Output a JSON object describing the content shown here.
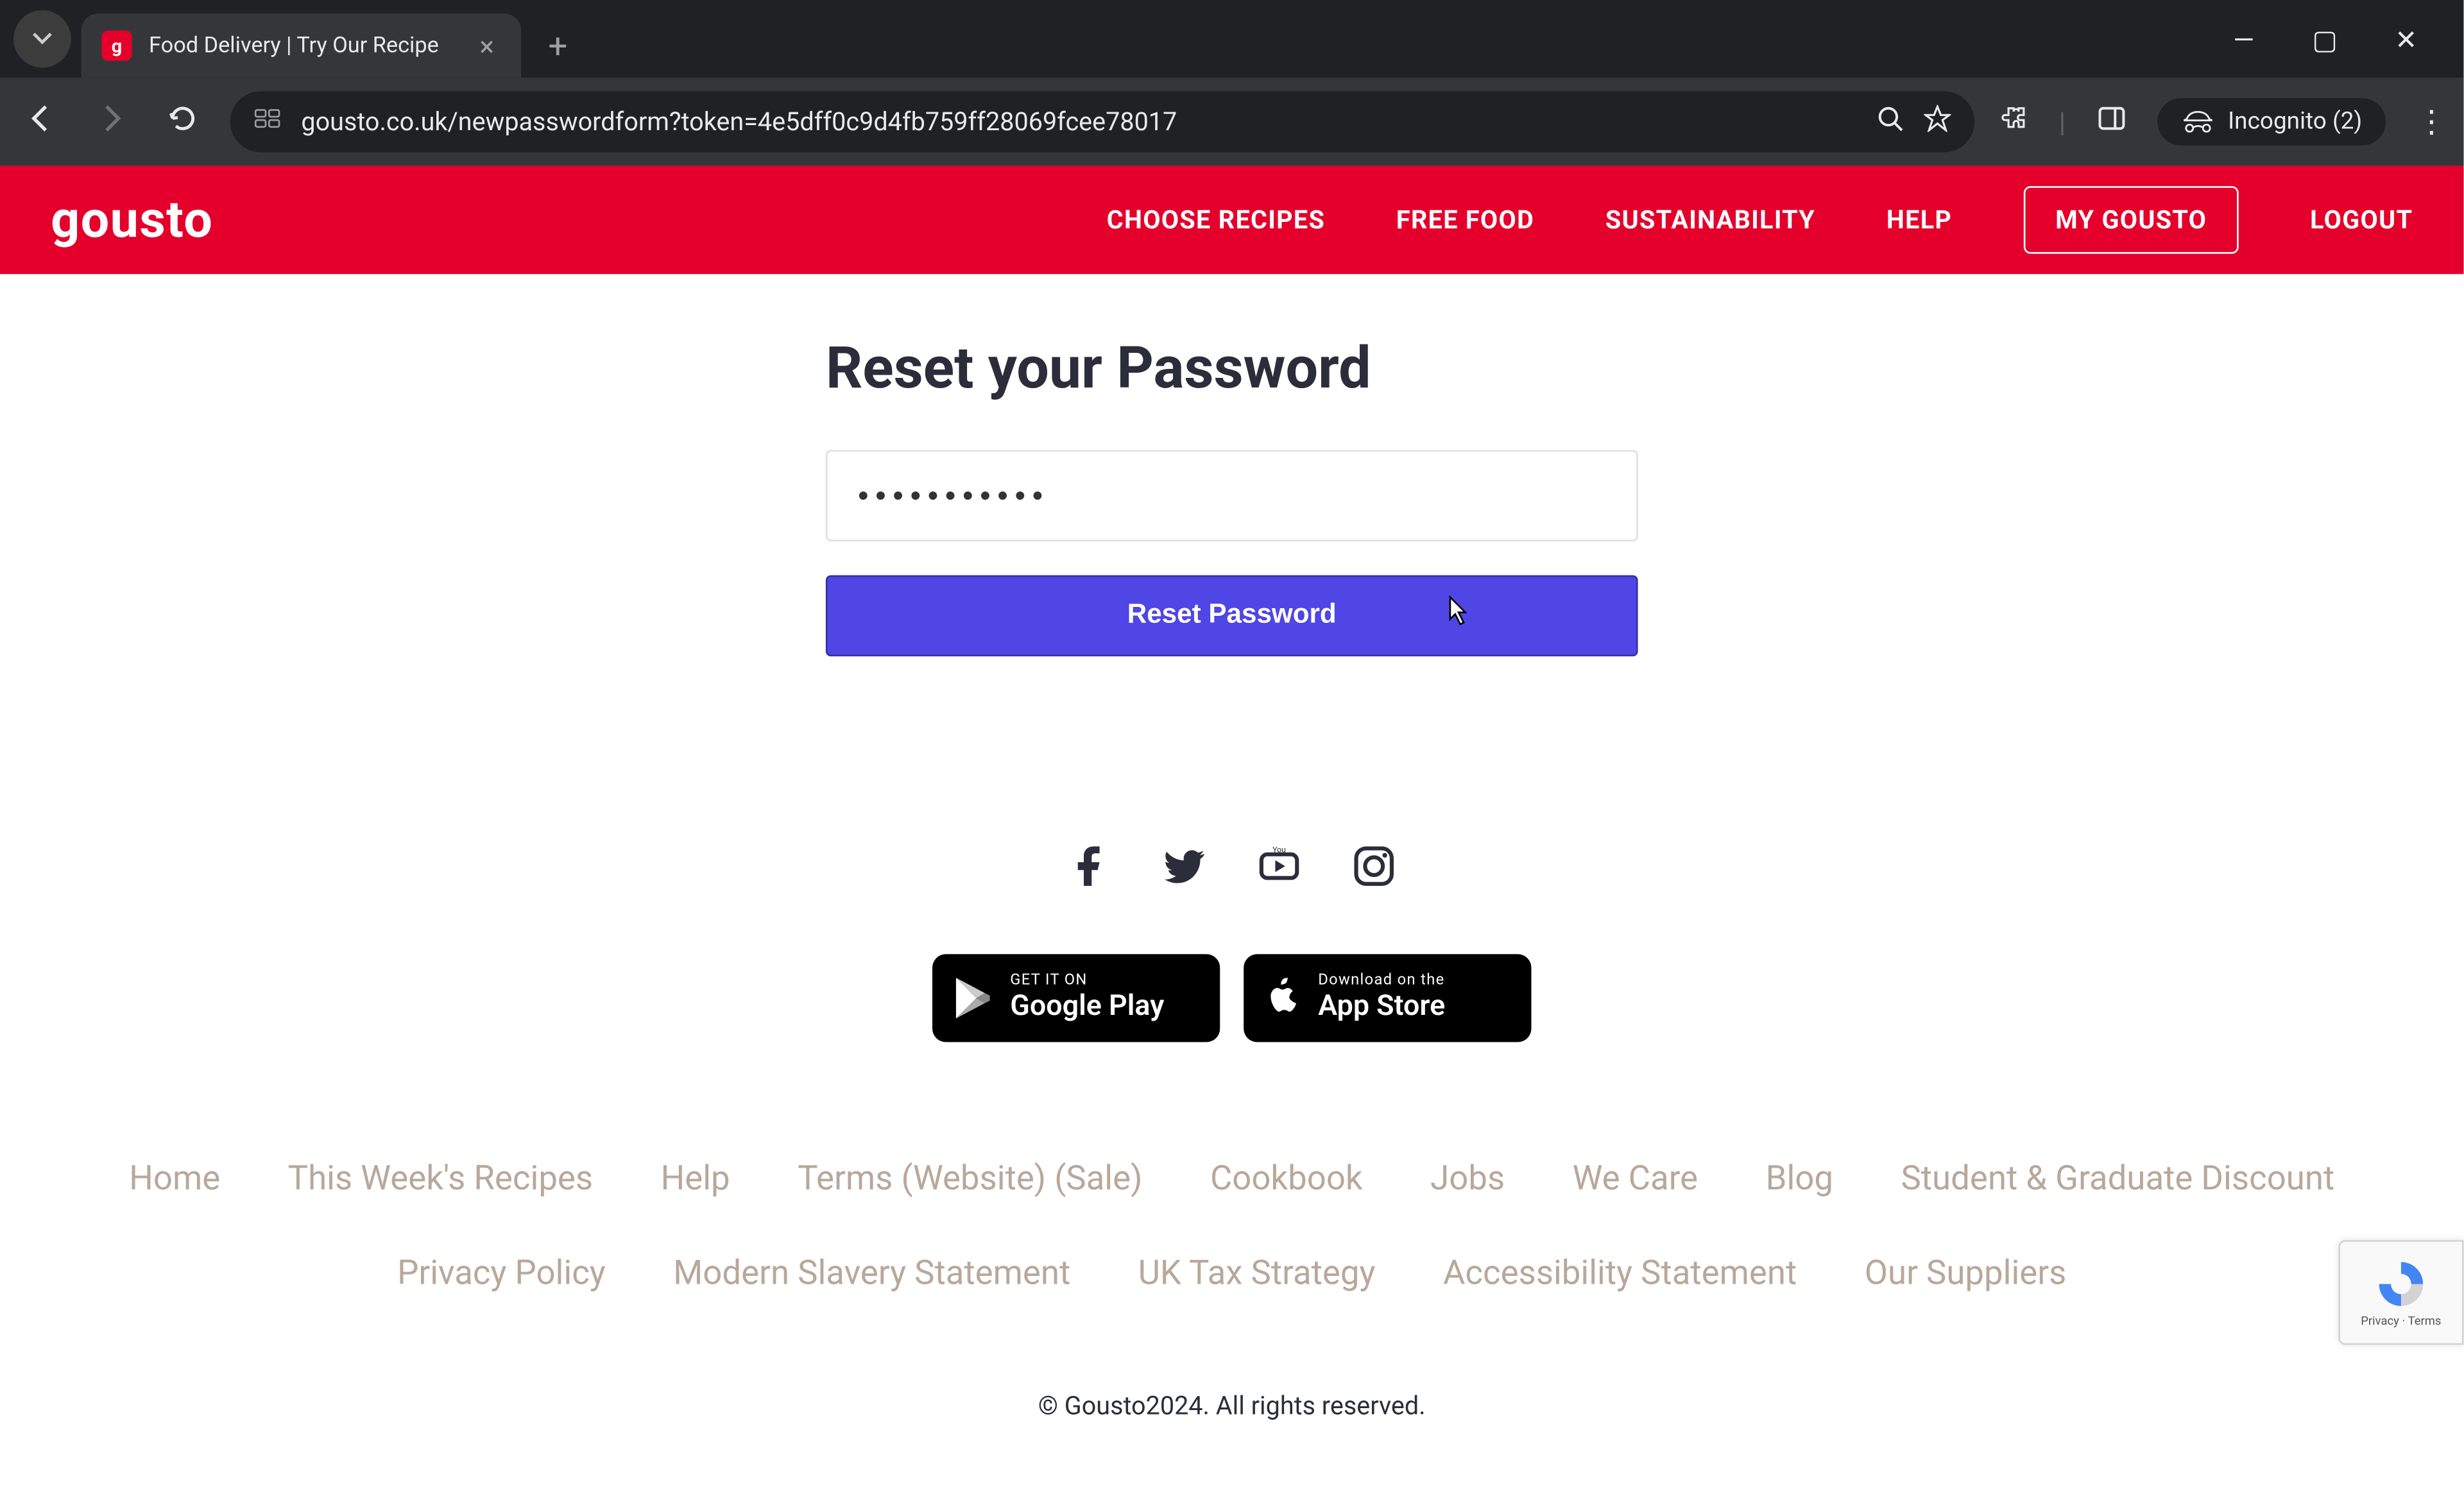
{
  "browser": {
    "tab_title": "Food Delivery | Try Our Recipe",
    "url": "gousto.co.uk/newpasswordform?token=4e5dff0c9d4fb759ff28069fcee78017",
    "incognito_label": "Incognito (2)"
  },
  "header": {
    "logo": "gousto",
    "nav": {
      "choose_recipes": "CHOOSE RECIPES",
      "free_food": "FREE FOOD",
      "sustainability": "SUSTAINABILITY",
      "help": "HELP",
      "my_gousto": "MY GOUSTO",
      "logout": "LOGOUT"
    }
  },
  "main": {
    "title": "Reset your Password",
    "password_value": "•••••••••••",
    "reset_button": "Reset Password"
  },
  "footer": {
    "google_play": {
      "small": "GET IT ON",
      "big": "Google Play"
    },
    "app_store": {
      "small": "Download on the",
      "big": "App Store"
    },
    "links": [
      "Home",
      "This Week's Recipes",
      "Help",
      "Terms (Website) (Sale)",
      "Cookbook",
      "Jobs",
      "We Care",
      "Blog",
      "Student & Graduate Discount",
      "Privacy Policy",
      "Modern Slavery Statement",
      "UK Tax Strategy",
      "Accessibility Statement",
      "Our Suppliers"
    ],
    "copyright": "© Gousto2024. All rights reserved."
  },
  "recaptcha": {
    "line1": "Privacy",
    "line2": "Terms"
  }
}
